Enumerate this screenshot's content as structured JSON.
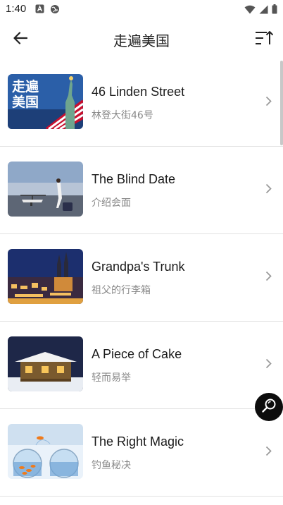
{
  "status_bar": {
    "time": "1:40",
    "left_icons": [
      "notification-a-icon",
      "globe-icon"
    ],
    "right_icons": [
      "wifi-icon",
      "signal-icon",
      "battery-icon"
    ]
  },
  "header": {
    "title": "走遍美国",
    "back_icon": "arrow-left-icon",
    "sort_icon": "sort-ascending-icon"
  },
  "lessons": [
    {
      "title": "46 Linden Street",
      "subtitle": "林登大街46号",
      "thumb_text_line1": "走遍",
      "thumb_text_line2": "美国"
    },
    {
      "title": "The Blind Date",
      "subtitle": "介绍会面"
    },
    {
      "title": "Grandpa's Trunk",
      "subtitle": "祖父的行李箱"
    },
    {
      "title": "A Piece of Cake",
      "subtitle": "轻而易举"
    },
    {
      "title": "The Right Magic",
      "subtitle": "钓鱼秘决"
    }
  ],
  "fab": {
    "icon": "search-icon"
  },
  "colors": {
    "fab_bg": "#0d0d0d",
    "divider": "#e2e2e2",
    "subtitle": "#8a8a8a"
  }
}
